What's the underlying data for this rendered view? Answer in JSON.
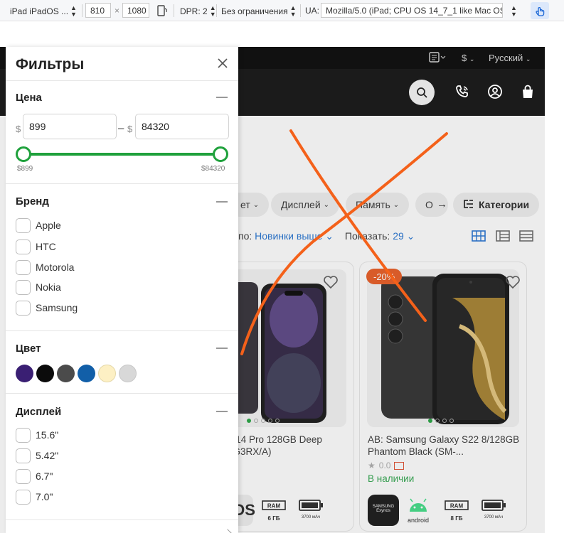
{
  "devtools": {
    "device": "iPad iPadOS ...",
    "width": "810",
    "times": "×",
    "height": "1080",
    "dpr": "DPR: 2",
    "throttling": "Без ограничения",
    "ua_label": "UA:",
    "ua_value": "Mozilla/5.0 (iPad; CPU OS 14_7_1 like Mac OS"
  },
  "site": {
    "currency": "$",
    "language": "Русский",
    "chips": [
      "ет",
      "Дисплей",
      "Память",
      "О"
    ],
    "categories_label": "Категории",
    "sort_prefix": "по:",
    "sort_value": "Новинки выше",
    "show_label": "Показать:",
    "show_value": "29",
    "discount_badge": "-20%",
    "product1_title_line1": "e 14 Pro 128GB Deep",
    "product1_title_line2": "0G3RX/A)",
    "product2_title_line1": "AB: Samsung Galaxy S22 8/128GB",
    "product2_title_line2": "Phantom Black (SM-...",
    "product2_rating": "0.0",
    "product2_stock": "В наличии",
    "spec_ram": "RAM",
    "spec_ram_value": "8 ГБ",
    "spec_ram_value_p1": "6 ГБ",
    "spec_battery_value": "3700 мАч",
    "spec_os_samsung": "SAMSUNG Exynos",
    "spec_os_android": "android",
    "spec_os_ios": "OS"
  },
  "filters": {
    "title": "Фильтры",
    "price": {
      "title": "Цена",
      "currency": "$",
      "min_value": "899",
      "max_value": "84320",
      "dash": "–",
      "min_label": "$899",
      "max_label": "$84320"
    },
    "brand": {
      "title": "Бренд",
      "items": [
        "Apple",
        "HTC",
        "Motorola",
        "Nokia",
        "Samsung"
      ]
    },
    "color": {
      "title": "Цвет",
      "swatches": [
        "#3a1f73",
        "#0b0b0b",
        "#4b4b4b",
        "#125fa8",
        "#fdf0c4",
        "#d8d8d8"
      ]
    },
    "display": {
      "title": "Дисплей",
      "items": [
        "15.6\"",
        "5.42\"",
        "6.7\"",
        "7.0\""
      ]
    }
  },
  "colors": {
    "accent_green": "#1fa13c",
    "link_blue": "#1e6fd0",
    "badge_orange": "#e8571c",
    "cross_orange": "#f4611a"
  }
}
